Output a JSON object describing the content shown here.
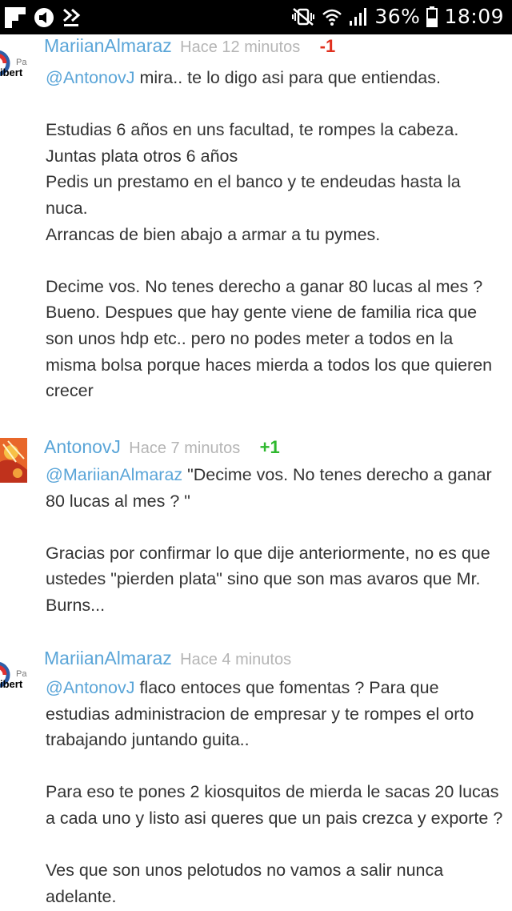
{
  "status_bar": {
    "battery_percent": "36%",
    "time": "18:09",
    "left_icons": [
      "flipboard-icon",
      "volume-icon",
      "download-icon"
    ],
    "right_icons": [
      "vibrate-icon",
      "wifi-icon",
      "signal-icon",
      "battery-icon"
    ]
  },
  "colors": {
    "author": "#5aa5d8",
    "time": "#b5b5b5",
    "negative": "#e0301e",
    "positive": "#2eb82e",
    "text": "#333333"
  },
  "comments": [
    {
      "author": "MariianAlmaraz",
      "time": "Hace 12 minutos",
      "score": "-1",
      "avatar_text": [
        "Par",
        "ibert"
      ],
      "mention": "@AntonovJ",
      "first_line_rest": " mira.. te lo digo asi para que entiendas.",
      "lines": [
        "Estudias 6 años en uns facultad, te rompes la cabeza.",
        "Juntas plata otros 6 años",
        "Pedis un prestamo en el banco y te endeudas hasta la",
        "nuca.",
        "Arrancas de bien abajo a armar a tu pymes.",
        "Decime vos. No tenes derecho a ganar 80 lucas al mes ?",
        "Bueno. Despues que hay gente viene de familia rica que",
        "son unos hdp etc.. pero no podes meter a todos en la",
        "misma bolsa porque haces mierda a todos los que quieren",
        "crecer"
      ]
    },
    {
      "author": "AntonovJ",
      "time": "Hace 7 minutos",
      "score": "+1",
      "mention": "@MariianAlmaraz",
      "first_line_rest": " \"Decime vos. No tenes derecho a ganar",
      "lines": [
        "80 lucas al mes ? \"",
        "Gracias por confirmar lo que dije anteriormente, no es que",
        "ustedes \"pierden plata\" sino que son mas avaros que Mr.",
        "Burns..."
      ]
    },
    {
      "author": "MariianAlmaraz",
      "time": "Hace 4 minutos",
      "score": "",
      "avatar_text": [
        "Par",
        "ibert"
      ],
      "mention": "@AntonovJ",
      "first_line_rest": " flaco entoces que fomentas ? Para que",
      "lines": [
        "estudias administracion de empresar y te rompes el orto",
        "trabajando juntando guita..",
        "Para eso te pones 2 kiosquitos de mierda le sacas 20 lucas",
        "a cada uno y listo asi queres que un pais crezca y exporte ?",
        "Ves que son unos pelotudos no vamos a salir nunca",
        "adelante."
      ]
    }
  ]
}
